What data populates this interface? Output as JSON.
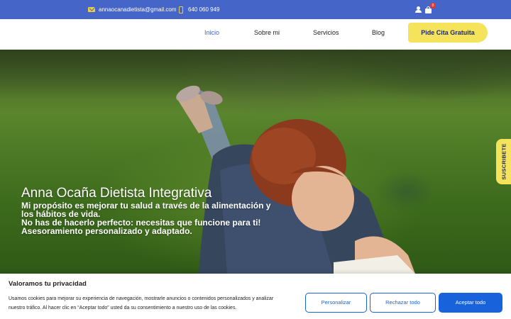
{
  "topbar": {
    "email": "annaocanadietista@gmail.com",
    "phone": "640 060 949",
    "cart_count": "0",
    "icons": {
      "email": "envelope-icon",
      "phone": "mobile-phone-icon",
      "user": "user-icon",
      "cart": "shopping-bag-icon"
    },
    "bg_color": "#4566c8",
    "icon_color": "#f2cf3a"
  },
  "nav": {
    "items": [
      {
        "label": "Inicio"
      },
      {
        "label": "Sobre mi"
      },
      {
        "label": "Servicios"
      },
      {
        "label": "Blog"
      }
    ],
    "active": "Inicio",
    "cta": "Pide Cita Gratuita",
    "cta_color": "#f6e35c"
  },
  "hero": {
    "title": "Anna Ocaña Dietista Integrativa",
    "lines": [
      "Mi propósito es mejorar tu salud a través de la alimentación y",
      "los hábitos de vida.",
      "No has de hacerlo perfecto: necesitas que funcione para ti!",
      "Asesoramiento personalizado y adaptado."
    ]
  },
  "subscribe_tab": "SUSCRIBETE",
  "cookie": {
    "title": "Valoramos tu privacidad",
    "text_lines": [
      "Usamos cookies para mejorar su experiencia de navegación, mostrarle anuncios o contenidos personalizados y analizar",
      "nuestro tráfico. Al hacer clic en “Aceptar todo” usted da su consentimiento a nuestro uso de las cookies."
    ],
    "buttons": {
      "customize": "Personalizar",
      "reject": "Rechazar todo",
      "accept": "Aceptar todo"
    },
    "accent_color": "#1863dc"
  }
}
